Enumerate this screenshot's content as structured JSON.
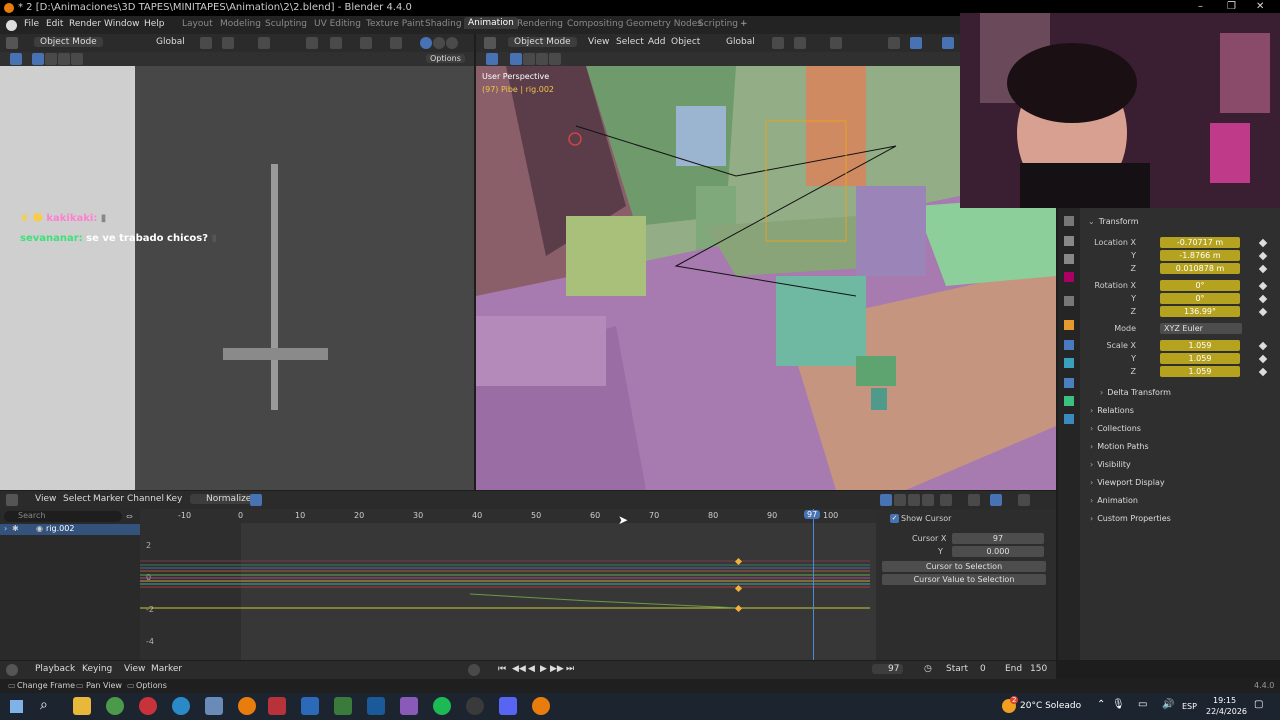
{
  "window": {
    "title": "* 2 [D:\\Animaciones\\3D TAPES\\MINITAPES\\Animation\\2\\2.blend] - Blender 4.4.0",
    "minimize": "–",
    "maximize": "❐",
    "close": "✕"
  },
  "menu": [
    "File",
    "Edit",
    "Render",
    "Window",
    "Help"
  ],
  "workspaces": [
    "Layout",
    "Modeling",
    "Sculpting",
    "UV Editing",
    "Texture Paint",
    "Shading",
    "Animation",
    "Rendering",
    "Compositing",
    "Geometry Nodes",
    "Scripting"
  ],
  "workspace_add": "+",
  "left_viewport": {
    "mode": "Object Mode",
    "orientation": "Global",
    "options": "Options"
  },
  "chat": {
    "line1_user": "kakikaki:",
    "line2_user": "sevananar:",
    "line2_text": "se ve trabado chicos?"
  },
  "main_viewport": {
    "mode": "Object Mode",
    "menus": [
      "View",
      "Select",
      "Add",
      "Object"
    ],
    "orientation": "Global",
    "perspective": "User Perspective",
    "object_info": "(97) Pibe | rig.002"
  },
  "properties": {
    "transform_title": "Transform",
    "location_label": "Location X",
    "location": [
      "-0.70717 m",
      "-1.8766 m",
      "0.010878 m"
    ],
    "rotation_label": "Rotation X",
    "rotation": [
      "0°",
      "0°",
      "136.99°"
    ],
    "mode_label": "Mode",
    "mode_value": "XYZ Euler",
    "scale_label": "Scale X",
    "scale": [
      "1.059",
      "1.059",
      "1.059"
    ],
    "axis_y": "Y",
    "axis_z": "Z",
    "delta_transform": "Delta Transform",
    "sections": [
      "Relations",
      "Collections",
      "Motion Paths",
      "Visibility",
      "Viewport Display",
      "Animation",
      "Custom Properties"
    ]
  },
  "graph_editor": {
    "menus": [
      "View",
      "Select",
      "Marker",
      "Channel",
      "Key"
    ],
    "normalize": "Normalize",
    "search_placeholder": "Search",
    "channel_name": "rig.002",
    "frame_ticks": [
      "-10",
      "0",
      "10",
      "20",
      "30",
      "40",
      "50",
      "60",
      "70",
      "80",
      "90",
      "100"
    ],
    "current_frame": "97",
    "y_ticks": [
      "2",
      "0",
      "-2",
      "-4"
    ],
    "sidebar": {
      "show_cursor": "Show Cursor",
      "cursor_x_label": "Cursor X",
      "cursor_x": "97",
      "cursor_y_label": "Y",
      "cursor_y": "0.000",
      "cursor_to_selection": "Cursor to Selection",
      "cursor_value_to_selection": "Cursor Value to Selection"
    }
  },
  "timeline": {
    "menus": [
      "Playback",
      "Keying",
      "View",
      "Marker"
    ],
    "current_frame": "97",
    "start_label": "Start",
    "start": "0",
    "end_label": "End",
    "end": "150"
  },
  "status_bar": {
    "change_frame": "Change Frame",
    "pan_view": "Pan View",
    "options": "Options",
    "version": "4.4.0"
  },
  "taskbar": {
    "weather_badge": "2",
    "weather": "20°C Soleado",
    "language": "ESP",
    "time": "19:15",
    "date": "22/4/2026"
  },
  "colors": {
    "accent": "#4772b3",
    "active_field": "#b5a31f",
    "keyframe": "#f3b03a"
  }
}
